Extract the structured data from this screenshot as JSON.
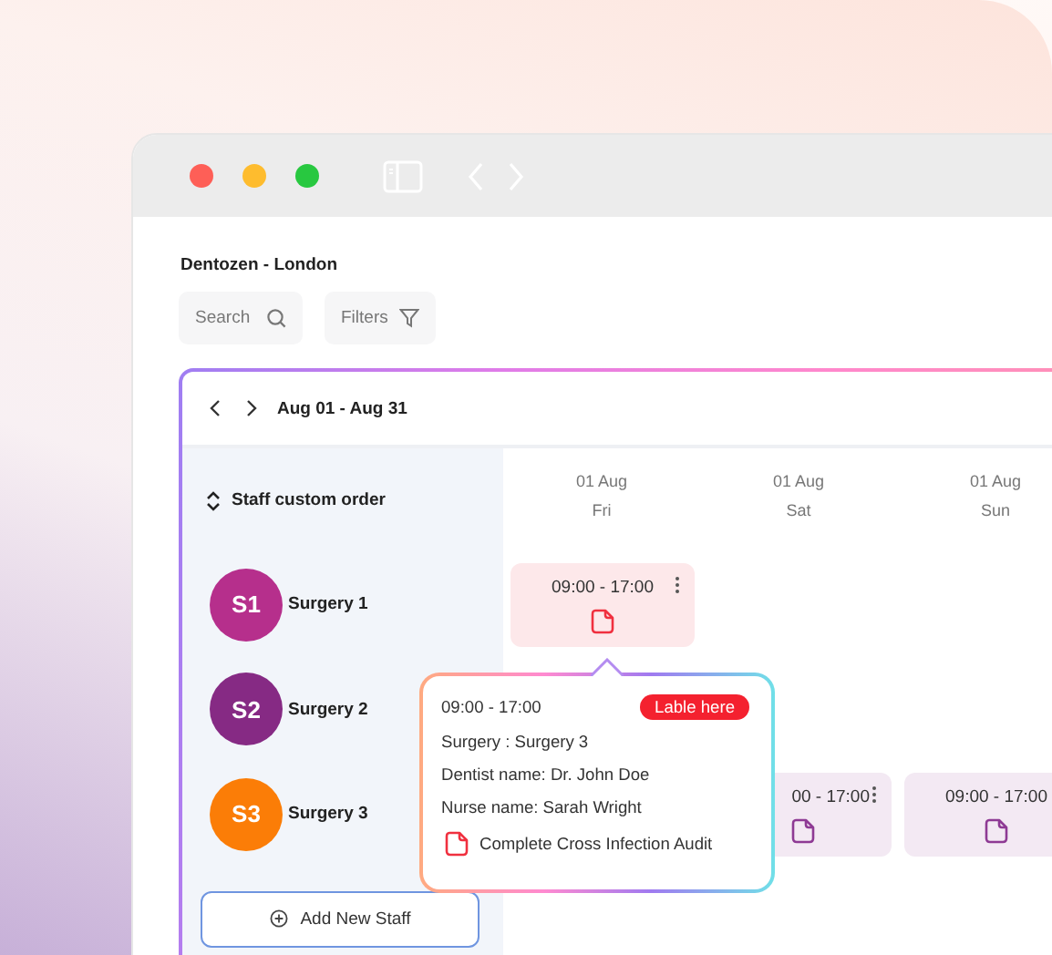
{
  "window": {
    "title": "Dentozen - London"
  },
  "toolbar": {
    "search": {
      "placeholder": "Search"
    },
    "filters": {
      "label": "Filters"
    }
  },
  "calendar": {
    "date_range": "Aug 01 - Aug 31",
    "sort_label": "Staff custom order",
    "days": [
      {
        "date": "01 Aug",
        "day": "Fri"
      },
      {
        "date": "01 Aug",
        "day": "Sat"
      },
      {
        "date": "01 Aug",
        "day": "Sun"
      }
    ],
    "staff": [
      {
        "initials": "S1",
        "name": "Surgery 1",
        "color": "#b62f8c",
        "shifts": [
          {
            "kind": "shift",
            "time": "09:00 - 17:00",
            "color": "#f0303f",
            "menu": true
          },
          {
            "kind": "empty"
          },
          {
            "kind": "empty"
          }
        ]
      },
      {
        "initials": "S2",
        "name": "Surgery 2",
        "color": "#862a84",
        "shifts": [
          {
            "kind": "empty"
          },
          {
            "kind": "empty"
          },
          {
            "kind": "empty"
          }
        ]
      },
      {
        "initials": "S3",
        "name": "Surgery 3",
        "color": "#fb7d07",
        "shifts": [
          {
            "kind": "empty"
          },
          {
            "kind": "shift",
            "time": "00 - 17:00",
            "color": "#8e3a94",
            "menu": true
          },
          {
            "kind": "shift",
            "time": "09:00 - 17:00",
            "color": "#8e3a94"
          }
        ]
      }
    ],
    "add_button": "Add New Staff"
  },
  "popup": {
    "time": "09:00 - 17:00",
    "tag": "Lable here",
    "lines": [
      "Surgery : Surgery 3",
      "Dentist name: Dr. John Doe",
      "Nurse name: Sarah Wright"
    ],
    "task": "Complete Cross Infection Audit"
  }
}
